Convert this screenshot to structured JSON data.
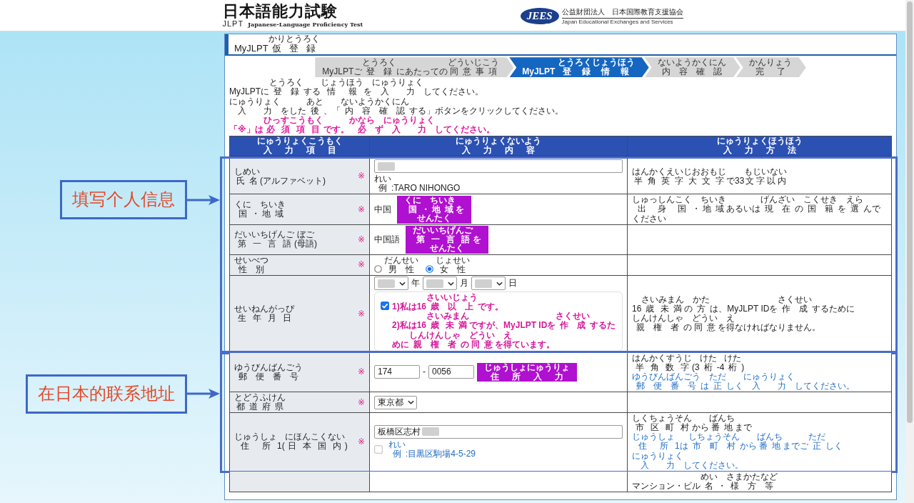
{
  "header": {
    "logo": {
      "title": "日本語能力試験",
      "mark": "JLPT",
      "subtitle": "Japanese-Language Proficiency Test"
    },
    "org": {
      "badge": "JEES",
      "name": "公益財団法人　日本国際教育支援協会",
      "name_en": "Japan Educational Exchanges and Services"
    }
  },
  "panel": {
    "title": [
      {
        "text": "MyJLPT"
      },
      {
        "text": "仮登録",
        "ruby": "かりとうろく"
      }
    ],
    "steps": [
      {
        "label": [
          {
            "text": "MyJLPTご"
          },
          {
            "text": "登録",
            "ruby": "とうろく"
          },
          {
            "text": "にあたっての"
          },
          {
            "text": "同意事項",
            "ruby": "どういじこう"
          }
        ],
        "selected": false
      },
      {
        "label": [
          {
            "text": "MyJLPT "
          },
          {
            "text": "登録情報",
            "ruby": "とうろくじょうほう"
          }
        ],
        "selected": true
      },
      {
        "label": [
          {
            "text": "内容確認",
            "ruby": "ないようかくにん"
          }
        ],
        "selected": false
      },
      {
        "label": [
          {
            "text": "完了",
            "ruby": "かんりょう"
          }
        ],
        "selected": false
      }
    ],
    "instructions": [
      [
        {
          "text": "MyJLPTに"
        },
        {
          "text": "登録",
          "ruby": "とうろく"
        },
        {
          "text": "する"
        },
        {
          "text": "情報",
          "ruby": "じょうほう"
        },
        {
          "text": "を"
        },
        {
          "text": "入力",
          "ruby": "にゅうりょく"
        },
        {
          "text": "してください。"
        }
      ],
      [
        {
          "text": "入力",
          "ruby": "にゅうりょく"
        },
        {
          "text": "をした"
        },
        {
          "text": "後",
          "ruby": "あと"
        },
        {
          "text": "、「"
        },
        {
          "text": "内容確認",
          "ruby": "ないようかくにん"
        },
        {
          "text": "する」ボタンをクリックしてください。"
        }
      ]
    ],
    "required_note": [
      {
        "text": "「※」は"
      },
      {
        "text": "必須項目",
        "ruby": "ひっすこうもく"
      },
      {
        "text": "です。"
      },
      {
        "text": "必",
        "ruby": "かなら"
      },
      {
        "text": "ず"
      },
      {
        "text": "入力",
        "ruby": "にゅうりょく"
      },
      {
        "text": "してください。"
      }
    ],
    "table": {
      "columns": [
        [
          {
            "text": "入力項目",
            "ruby": "にゅうりょくこうもく"
          }
        ],
        [
          {
            "text": "入力内容",
            "ruby": "にゅうりょくないよう"
          }
        ],
        [
          {
            "text": "入力方法",
            "ruby": "にゅうりょくほうほう"
          }
        ]
      ],
      "sections": [
        {
          "callout": "填写个人信息",
          "rows": [
            {
              "label": [
                {
                  "text": "氏名",
                  "ruby": "しめい"
                },
                {
                  "text": "(アルファベット)"
                }
              ],
              "required_mark": "※",
              "content": [
                [
                  {
                    "kind": "input",
                    "redacted": true
                  }
                ],
                [
                  {
                    "kind": "text",
                    "parts": [
                      {
                        "text": "例",
                        "ruby": "れい"
                      },
                      {
                        "text": ":TARO NIHONGO"
                      }
                    ]
                  }
                ]
              ],
              "method": [
                {
                  "kind": "text",
                  "parts": [
                    {
                      "text": "半角英字大文字",
                      "ruby": "はんかくえいじおおもじ"
                    },
                    {
                      "text": "で33"
                    },
                    {
                      "text": "文字以内",
                      "ruby": "もじいない"
                    }
                  ]
                }
              ]
            },
            {
              "label": [
                {
                  "text": "国",
                  "ruby": "くに"
                },
                {
                  "text": "・"
                },
                {
                  "text": "地域",
                  "ruby": "ちいき"
                }
              ],
              "required_mark": "※",
              "content": [
                [
                  {
                    "kind": "text",
                    "parts": [
                      {
                        "text": "中国"
                      }
                    ]
                  }
                ],
                [
                  {
                    "kind": "button",
                    "lines": [
                      [
                        {
                          "text": "国",
                          "ruby": "くに"
                        },
                        {
                          "text": "・"
                        },
                        {
                          "text": "地域",
                          "ruby": "ちいき"
                        },
                        {
                          "text": "を"
                        }
                      ],
                      [
                        {
                          "text": "せんたく"
                        }
                      ]
                    ]
                  }
                ]
              ],
              "method": [
                {
                  "kind": "text",
                  "parts": [
                    {
                      "text": "出身国",
                      "ruby": "しゅっしんこく"
                    },
                    {
                      "text": "・"
                    },
                    {
                      "text": "地域",
                      "ruby": "ちいき"
                    },
                    {
                      "text": "あるいは"
                    },
                    {
                      "text": "現在",
                      "ruby": "げんざい"
                    },
                    {
                      "text": "の"
                    },
                    {
                      "text": "国籍",
                      "ruby": "こくせき"
                    },
                    {
                      "text": "を"
                    },
                    {
                      "text": "選",
                      "ruby": "えら"
                    },
                    {
                      "text": "んでください"
                    }
                  ]
                }
              ]
            },
            {
              "label": [
                {
                  "text": "第一言語",
                  "ruby": "だいいちげんご"
                },
                {
                  "text": "("
                },
                {
                  "text": "母語",
                  "ruby": "ぼご"
                },
                {
                  "text": ")"
                }
              ],
              "required_mark": "※",
              "content": [
                [
                  {
                    "kind": "text",
                    "parts": [
                      {
                        "text": "中国語"
                      }
                    ]
                  }
                ],
                [
                  {
                    "kind": "button",
                    "lines": [
                      [
                        {
                          "text": "第一言語",
                          "ruby": "だいいちげんご"
                        },
                        {
                          "text": "を"
                        }
                      ],
                      [
                        {
                          "text": "せんたく"
                        }
                      ]
                    ]
                  }
                ]
              ]
            },
            {
              "label": [
                {
                  "text": "性別",
                  "ruby": "せいべつ"
                }
              ],
              "required_mark": "※",
              "content": [
                [
                  {
                    "kind": "radio",
                    "parts": [
                      {
                        "text": "男性",
                        "ruby": "だんせい"
                      }
                    ],
                    "selected": false
                  },
                  {
                    "kind": "radio",
                    "parts": [
                      {
                        "text": "女性",
                        "ruby": "じょせい"
                      }
                    ],
                    "selected": true
                  }
                ]
              ]
            },
            {
              "label": [
                {
                  "text": "生年月日",
                  "ruby": "せいねんがっぴ"
                }
              ],
              "required_mark": "※",
              "content": [
                [
                  {
                    "kind": "select",
                    "redacted": true
                  },
                  {
                    "kind": "text",
                    "parts": [
                      {
                        "text": "年"
                      }
                    ]
                  },
                  {
                    "kind": "select",
                    "redacted": true
                  },
                  {
                    "kind": "text",
                    "parts": [
                      {
                        "text": "月"
                      }
                    ]
                  },
                  {
                    "kind": "select",
                    "redacted": true
                  },
                  {
                    "kind": "text",
                    "parts": [
                      {
                        "text": "日"
                      }
                    ]
                  }
                ],
                [
                  {
                    "kind": "consent",
                    "options": [
                      {
                        "kind": "checkbox",
                        "checked": true,
                        "parts": [
                          {
                            "text": "1)私は16"
                          },
                          {
                            "text": "歳",
                            "ruby": "さい"
                          },
                          {
                            "text": "以上",
                            "ruby": "いじょう"
                          },
                          {
                            "text": "です。"
                          }
                        ]
                      },
                      {
                        "kind": "plain",
                        "parts": [
                          {
                            "text": "2)私は16"
                          },
                          {
                            "text": "歳",
                            "ruby": "さい"
                          },
                          {
                            "text": "未満",
                            "ruby": "みまん"
                          },
                          {
                            "text": "ですが、MyJLPT IDを"
                          },
                          {
                            "text": "作成",
                            "ruby": "さくせい"
                          },
                          {
                            "text": "するために"
                          },
                          {
                            "text": "親権者",
                            "ruby": "しんけんしゃ"
                          },
                          {
                            "text": "の"
                          },
                          {
                            "text": "同意",
                            "ruby": "どうい"
                          },
                          {
                            "text": "を"
                          },
                          {
                            "text": "得",
                            "ruby": "え"
                          },
                          {
                            "text": "ています。"
                          }
                        ]
                      }
                    ]
                  }
                ]
              ],
              "method": [
                {
                  "kind": "text",
                  "parts": [
                    {
                      "text": "16"
                    },
                    {
                      "text": "歳",
                      "ruby": "さい"
                    },
                    {
                      "text": "未満",
                      "ruby": "みまん"
                    },
                    {
                      "text": "の"
                    },
                    {
                      "text": "方",
                      "ruby": "かた"
                    },
                    {
                      "text": "は、MyJLPT IDを"
                    },
                    {
                      "text": "作成",
                      "ruby": "さくせい"
                    },
                    {
                      "text": "するために"
                    },
                    {
                      "text": "親権者",
                      "ruby": "しんけんしゃ"
                    },
                    {
                      "text": "の"
                    },
                    {
                      "text": "同意",
                      "ruby": "どうい"
                    },
                    {
                      "text": "を"
                    },
                    {
                      "text": "得",
                      "ruby": "え"
                    },
                    {
                      "text": "なければなりません。"
                    }
                  ]
                }
              ]
            }
          ]
        },
        {
          "callout": "在日本的联系地址",
          "rows": [
            {
              "label": [
                {
                  "text": "郵便番号",
                  "ruby": "ゆうびんばんごう"
                }
              ],
              "required_mark": "※",
              "content": [
                [
                  {
                    "kind": "input",
                    "value": "174"
                  },
                  {
                    "kind": "text",
                    "parts": [
                      {
                        "text": "-"
                      }
                    ]
                  },
                  {
                    "kind": "input",
                    "value": "0056"
                  },
                  {
                    "kind": "button",
                    "lines": [
                      [
                        {
                          "text": "住所入力",
                          "ruby": "じゅうしょにゅうりょ"
                        }
                      ]
                    ]
                  }
                ]
              ],
              "method": [
                {
                  "kind": "text",
                  "parts": [
                    {
                      "text": "半角数字",
                      "ruby": "はんかくすうじ"
                    },
                    {
                      "text": "(3"
                    },
                    {
                      "text": "桁",
                      "ruby": "けた"
                    },
                    {
                      "text": "-4"
                    },
                    {
                      "text": "桁",
                      "ruby": "けた"
                    },
                    {
                      "text": ")"
                    }
                  ]
                },
                {
                  "kind": "hint",
                  "parts": [
                    {
                      "text": "郵便",
                      "ruby": "ゆうびん"
                    },
                    {
                      "text": "番号",
                      "ruby": "ばんごう"
                    },
                    {
                      "text": "は"
                    },
                    {
                      "text": "正",
                      "ruby": "ただ"
                    },
                    {
                      "text": "しく"
                    },
                    {
                      "text": "入力",
                      "ruby": "にゅうりょく"
                    },
                    {
                      "text": "してください。"
                    }
                  ]
                }
              ]
            },
            {
              "label": [
                {
                  "text": "都道府県",
                  "ruby": "とどうふけん"
                }
              ],
              "required_mark": "※",
              "content": [
                [
                  {
                    "kind": "select",
                    "value": "東京都"
                  }
                ]
              ]
            },
            {
              "label": [
                {
                  "text": "住所",
                  "ruby": "じゅうしょ"
                },
                {
                  "text": "1("
                },
                {
                  "text": "日本国内",
                  "ruby": "にほんこくない"
                },
                {
                  "text": ")"
                }
              ],
              "required_mark": "※",
              "content": [
                [
                  {
                    "kind": "input",
                    "value": "板橋区志村",
                    "redacted": true
                  }
                ],
                [
                  {
                    "kind": "checkbox",
                    "checked": false
                  }
                ],
                [
                  {
                    "kind": "hint",
                    "parts": [
                      {
                        "text": "例",
                        "ruby": "れい"
                      },
                      {
                        "text": ":目黒区駒場4-5-29"
                      }
                    ]
                  }
                ]
              ],
              "method": [
                {
                  "kind": "text",
                  "parts": [
                    {
                      "text": "市区町村",
                      "ruby": "しくちょうそん"
                    },
                    {
                      "text": "から"
                    },
                    {
                      "text": "番地",
                      "ruby": "ばんち"
                    },
                    {
                      "text": "まで"
                    }
                  ]
                },
                {
                  "kind": "hint",
                  "parts": [
                    {
                      "text": "住所",
                      "ruby": "じゅうしょ"
                    },
                    {
                      "text": "1は"
                    },
                    {
                      "text": "市町村",
                      "ruby": "しちょうそん"
                    },
                    {
                      "text": "から"
                    },
                    {
                      "text": "番地",
                      "ruby": "ばんち"
                    },
                    {
                      "text": "までご"
                    },
                    {
                      "text": "正",
                      "ruby": "ただ"
                    },
                    {
                      "text": "しく"
                    },
                    {
                      "text": "入力",
                      "ruby": "にゅうりょく"
                    },
                    {
                      "text": "してください。"
                    }
                  ]
                }
              ]
            }
          ]
        },
        {
          "rows": [
            {
              "method": [
                {
                  "kind": "text",
                  "parts": [
                    {
                      "text": "マンション・ビル"
                    },
                    {
                      "text": "名",
                      "ruby": "めい"
                    },
                    {
                      "text": "・"
                    },
                    {
                      "text": "様方等",
                      "ruby": "さまかたなど"
                    }
                  ]
                }
              ]
            }
          ]
        }
      ]
    }
  }
}
